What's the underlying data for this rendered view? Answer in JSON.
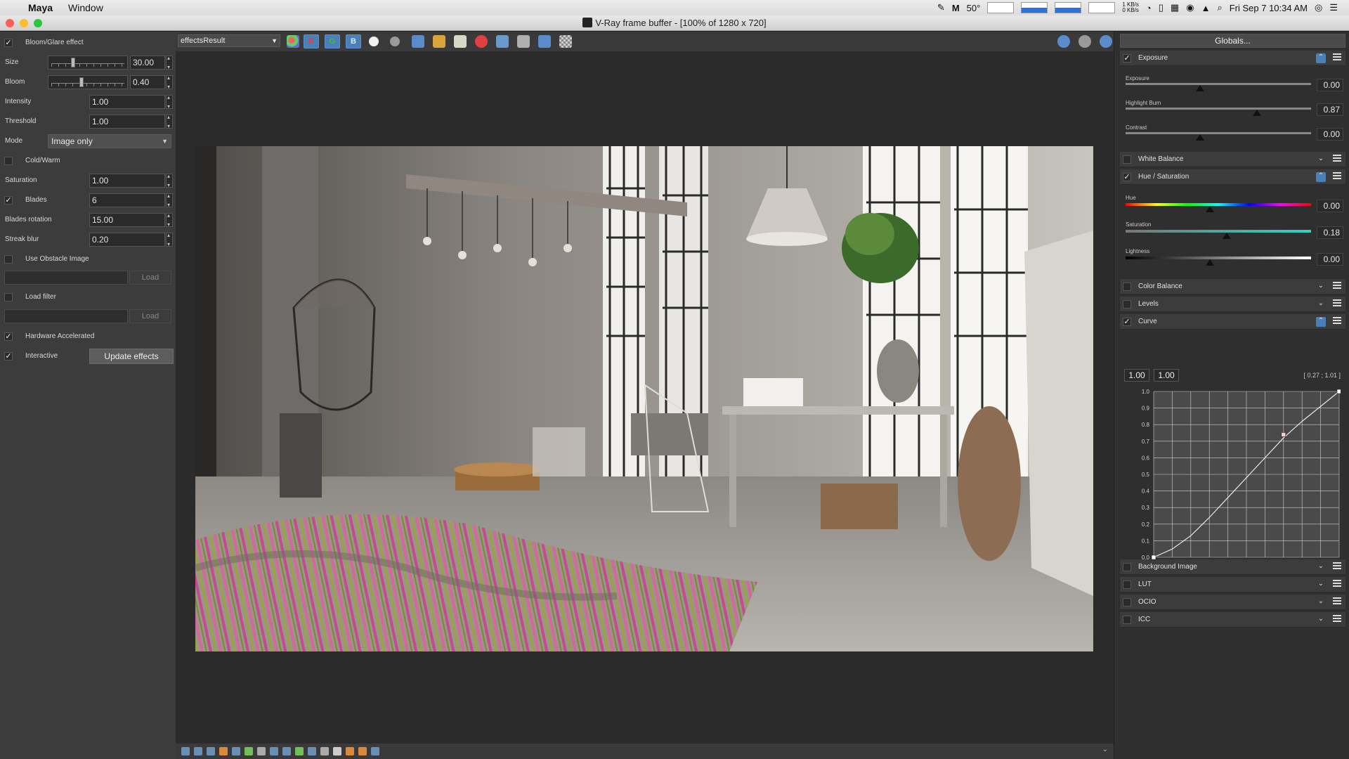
{
  "menubar": {
    "app": "Maya",
    "menu_window": "Window",
    "temperature": "50°",
    "net_up": "1 KB/s",
    "net_down": "0 KB/s",
    "clock": "Fri Sep 7  10:34 AM"
  },
  "window": {
    "title": "V-Ray frame buffer - [100% of 1280 x 720]"
  },
  "left": {
    "bloom_glare": "Bloom/Glare effect",
    "size_label": "Size",
    "size_value": "30.00",
    "bloom_label": "Bloom",
    "bloom_value": "0.40",
    "intensity_label": "Intensity",
    "intensity_value": "1.00",
    "threshold_label": "Threshold",
    "threshold_value": "1.00",
    "mode_label": "Mode",
    "mode_value": "Image only",
    "cold_warm": "Cold/Warm",
    "saturation_label": "Saturation",
    "saturation_value": "1.00",
    "blades_label": "Blades",
    "blades_value": "6",
    "blades_rotation_label": "Blades rotation",
    "blades_rotation_value": "15.00",
    "streak_blur_label": "Streak blur",
    "streak_blur_value": "0.20",
    "use_obstacle": "Use Obstacle Image",
    "load_label": "Load",
    "load_filter": "Load filter",
    "hardware_accel": "Hardware Accelerated",
    "interactive": "Interactive",
    "update_effects": "Update effects"
  },
  "toolbar": {
    "channel": "effectsResult",
    "r": "R",
    "g": "G",
    "b": "B"
  },
  "right": {
    "globals": "Globals...",
    "exposure_section": "Exposure",
    "exposure_label": "Exposure",
    "exposure_value": "0.00",
    "exposure_level": 0.4,
    "highlight_label": "Highlight Burn",
    "highlight_value": "0.87",
    "highlight_level": 0.71,
    "contrast_label": "Contrast",
    "contrast_value": "0.00",
    "contrast_level": 0.4,
    "white_balance": "White Balance",
    "hue_sat_section": "Hue / Saturation",
    "hue_label": "Hue",
    "hue_value": "0.00",
    "sat_label": "Saturation",
    "sat_value": "0.18",
    "light_label": "Lightness",
    "light_value": "0.00",
    "color_balance": "Color Balance",
    "levels": "Levels",
    "curve_section": "Curve",
    "curve_in": "1.00",
    "curve_out": "1.00",
    "curve_coord": "[ 0.27 ; 1.01 ]",
    "curve_ticks": [
      "0.0",
      "0.1",
      "0.2",
      "0.3",
      "0.4",
      "0.5",
      "0.6",
      "0.7",
      "0.8",
      "0.9",
      "1.0"
    ],
    "background_image": "Background Image",
    "lut": "LUT",
    "ocio": "OCIO",
    "icc": "ICC"
  },
  "chart_data": {
    "type": "line",
    "title": "",
    "x": [
      0.0,
      0.1,
      0.2,
      0.3,
      0.4,
      0.5,
      0.6,
      0.7,
      0.8,
      0.9,
      1.0
    ],
    "y": [
      0.0,
      0.05,
      0.13,
      0.24,
      0.36,
      0.48,
      0.6,
      0.72,
      0.82,
      0.91,
      1.0
    ],
    "control_points": [
      [
        0.0,
        0.0
      ],
      [
        0.7,
        0.74
      ],
      [
        1.0,
        1.0
      ]
    ],
    "xlim": [
      0,
      1
    ],
    "ylim": [
      0,
      1
    ],
    "grid": true
  }
}
